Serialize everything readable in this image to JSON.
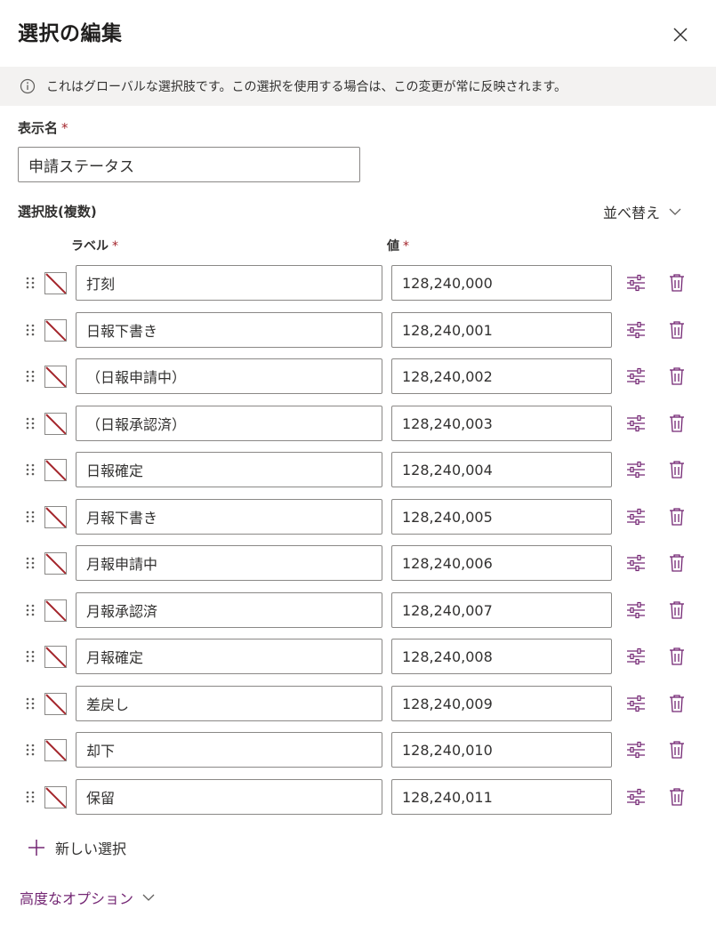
{
  "header": {
    "title": "選択の編集"
  },
  "info": {
    "text": "これはグローバルな選択肢です。この選択を使用する場合は、この変更が常に反映されます。"
  },
  "display_name": {
    "label": "表示名",
    "required_mark": "*",
    "value": "申請ステータス"
  },
  "choices_section": {
    "label": "選択肢(複数)",
    "sort_label": "並べ替え",
    "col_label": "ラベル",
    "col_value": "値",
    "required_mark": "*"
  },
  "choices": [
    {
      "label": "打刻",
      "value": "128,240,000"
    },
    {
      "label": "日報下書き",
      "value": "128,240,001"
    },
    {
      "label": "（日報申請中）",
      "value": "128,240,002"
    },
    {
      "label": "（日報承認済）",
      "value": "128,240,003"
    },
    {
      "label": "日報確定",
      "value": "128,240,004"
    },
    {
      "label": "月報下書き",
      "value": "128,240,005"
    },
    {
      "label": "月報申請中",
      "value": "128,240,006"
    },
    {
      "label": "月報承認済",
      "value": "128,240,007"
    },
    {
      "label": "月報確定",
      "value": "128,240,008"
    },
    {
      "label": "差戻し",
      "value": "128,240,009"
    },
    {
      "label": "却下",
      "value": "128,240,010"
    },
    {
      "label": "保留",
      "value": "128,240,011"
    }
  ],
  "footer": {
    "new_choice_label": "新しい選択",
    "advanced_label": "高度なオプション"
  },
  "colors": {
    "accent": "#742774",
    "required": "#a4262c",
    "info_bg": "#f3f2f1",
    "no_color_slash": "#a4262c"
  },
  "icons": {
    "close": "close-icon",
    "info": "info-icon",
    "sort": "chevron-down-icon",
    "drag": "drag-handle-icon",
    "color": "no-color-icon",
    "props": "sliders-icon",
    "delete": "trash-icon",
    "add": "plus-icon",
    "advanced": "chevron-down-icon"
  }
}
